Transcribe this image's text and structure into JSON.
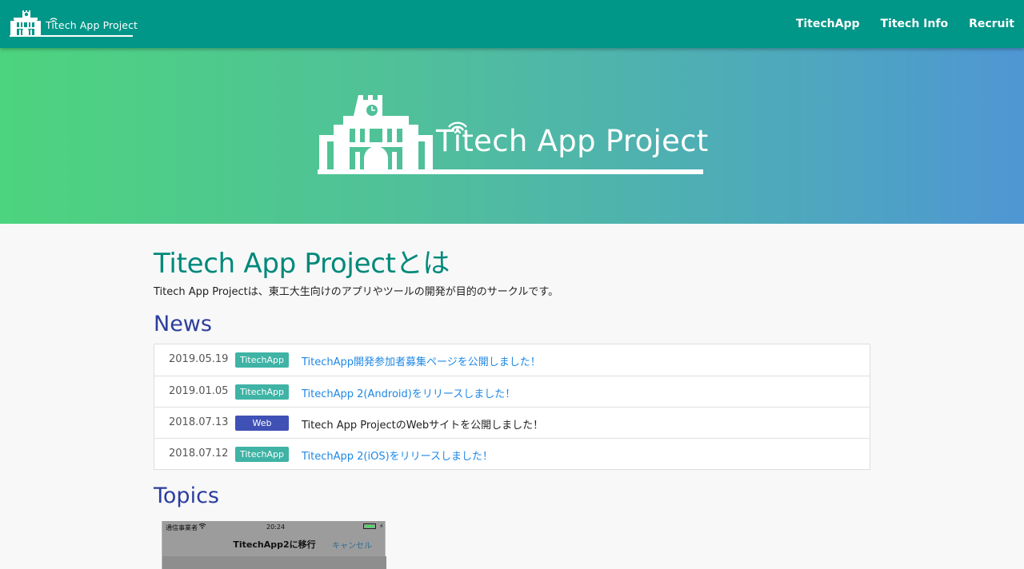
{
  "navbar": {
    "brand_text": "Titech App Project",
    "links": [
      "TitechApp",
      "Titech Info",
      "Recruit"
    ]
  },
  "hero": {
    "title": "Titech App Project"
  },
  "about": {
    "title": "Titech App Projectとは",
    "description": "Titech App Projectは、東工大生向けのアプリやツールの開発が目的のサークルです。"
  },
  "news": {
    "title": "News",
    "items": [
      {
        "date": "2019.05.19",
        "badge": "TitechApp",
        "badge_color": "#3fb3a5",
        "text": "TitechApp開発参加者募集ページを公開しました！",
        "is_link": true
      },
      {
        "date": "2019.01.05",
        "badge": "TitechApp",
        "badge_color": "#3fb3a5",
        "text": "TitechApp 2(Android)をリリースしました！",
        "is_link": true
      },
      {
        "date": "2018.07.13",
        "badge": "Web",
        "badge_color": "#3f51b5",
        "text": "Titech App ProjectのWebサイトを公開しました！",
        "is_link": false
      },
      {
        "date": "2018.07.12",
        "badge": "TitechApp",
        "badge_color": "#3fb3a5",
        "text": "TitechApp 2(iOS)をリリースしました！",
        "is_link": true
      }
    ]
  },
  "topics": {
    "title": "Topics",
    "screenshot": {
      "carrier": "通信事業者",
      "time": "20:24",
      "nav_title": "TitechApp2に移行",
      "cancel": "キャンセル"
    }
  },
  "colors": {
    "navbar": "#009688",
    "heading_teal": "#00897b",
    "heading_blue": "#2c3e9e",
    "link": "#1e88e5",
    "badge_teal": "#3fb3a5",
    "badge_web": "#3f51b5"
  }
}
